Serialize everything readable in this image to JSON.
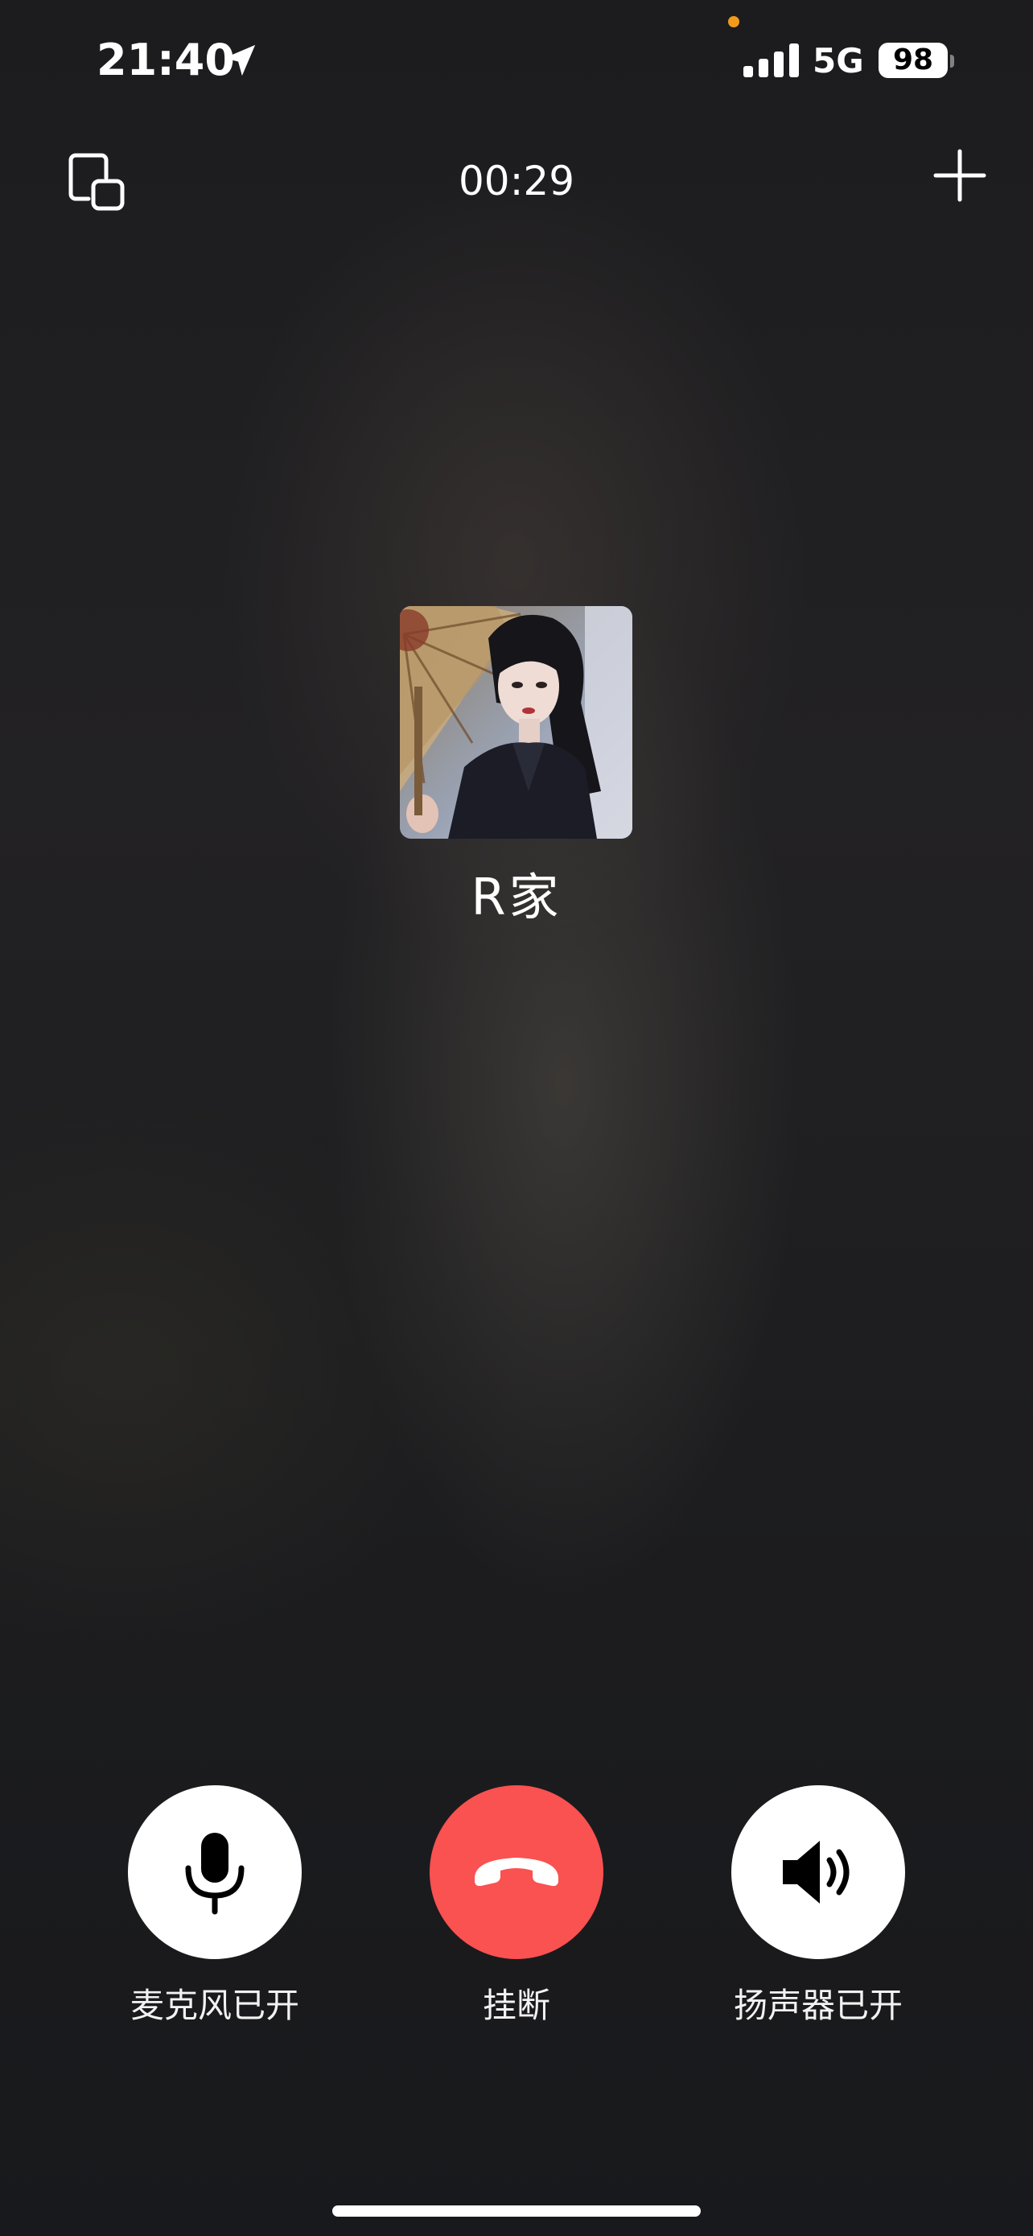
{
  "status_bar": {
    "time": "21:40",
    "network": "5G",
    "battery": "98",
    "icons": [
      "location-arrow-icon",
      "cellular-signal-icon",
      "battery-icon"
    ],
    "indicator_color": "#f29a1c"
  },
  "header": {
    "timer": "00:29",
    "left_icon": "minimize-window-icon",
    "right_icon": "plus-icon"
  },
  "contact": {
    "name": "R家",
    "avatar": "avatar-photo"
  },
  "controls": {
    "mic_label": "麦克风已开",
    "hangup_label": "挂断",
    "speaker_label": "扬声器已开",
    "hangup_color": "#fa5151"
  }
}
